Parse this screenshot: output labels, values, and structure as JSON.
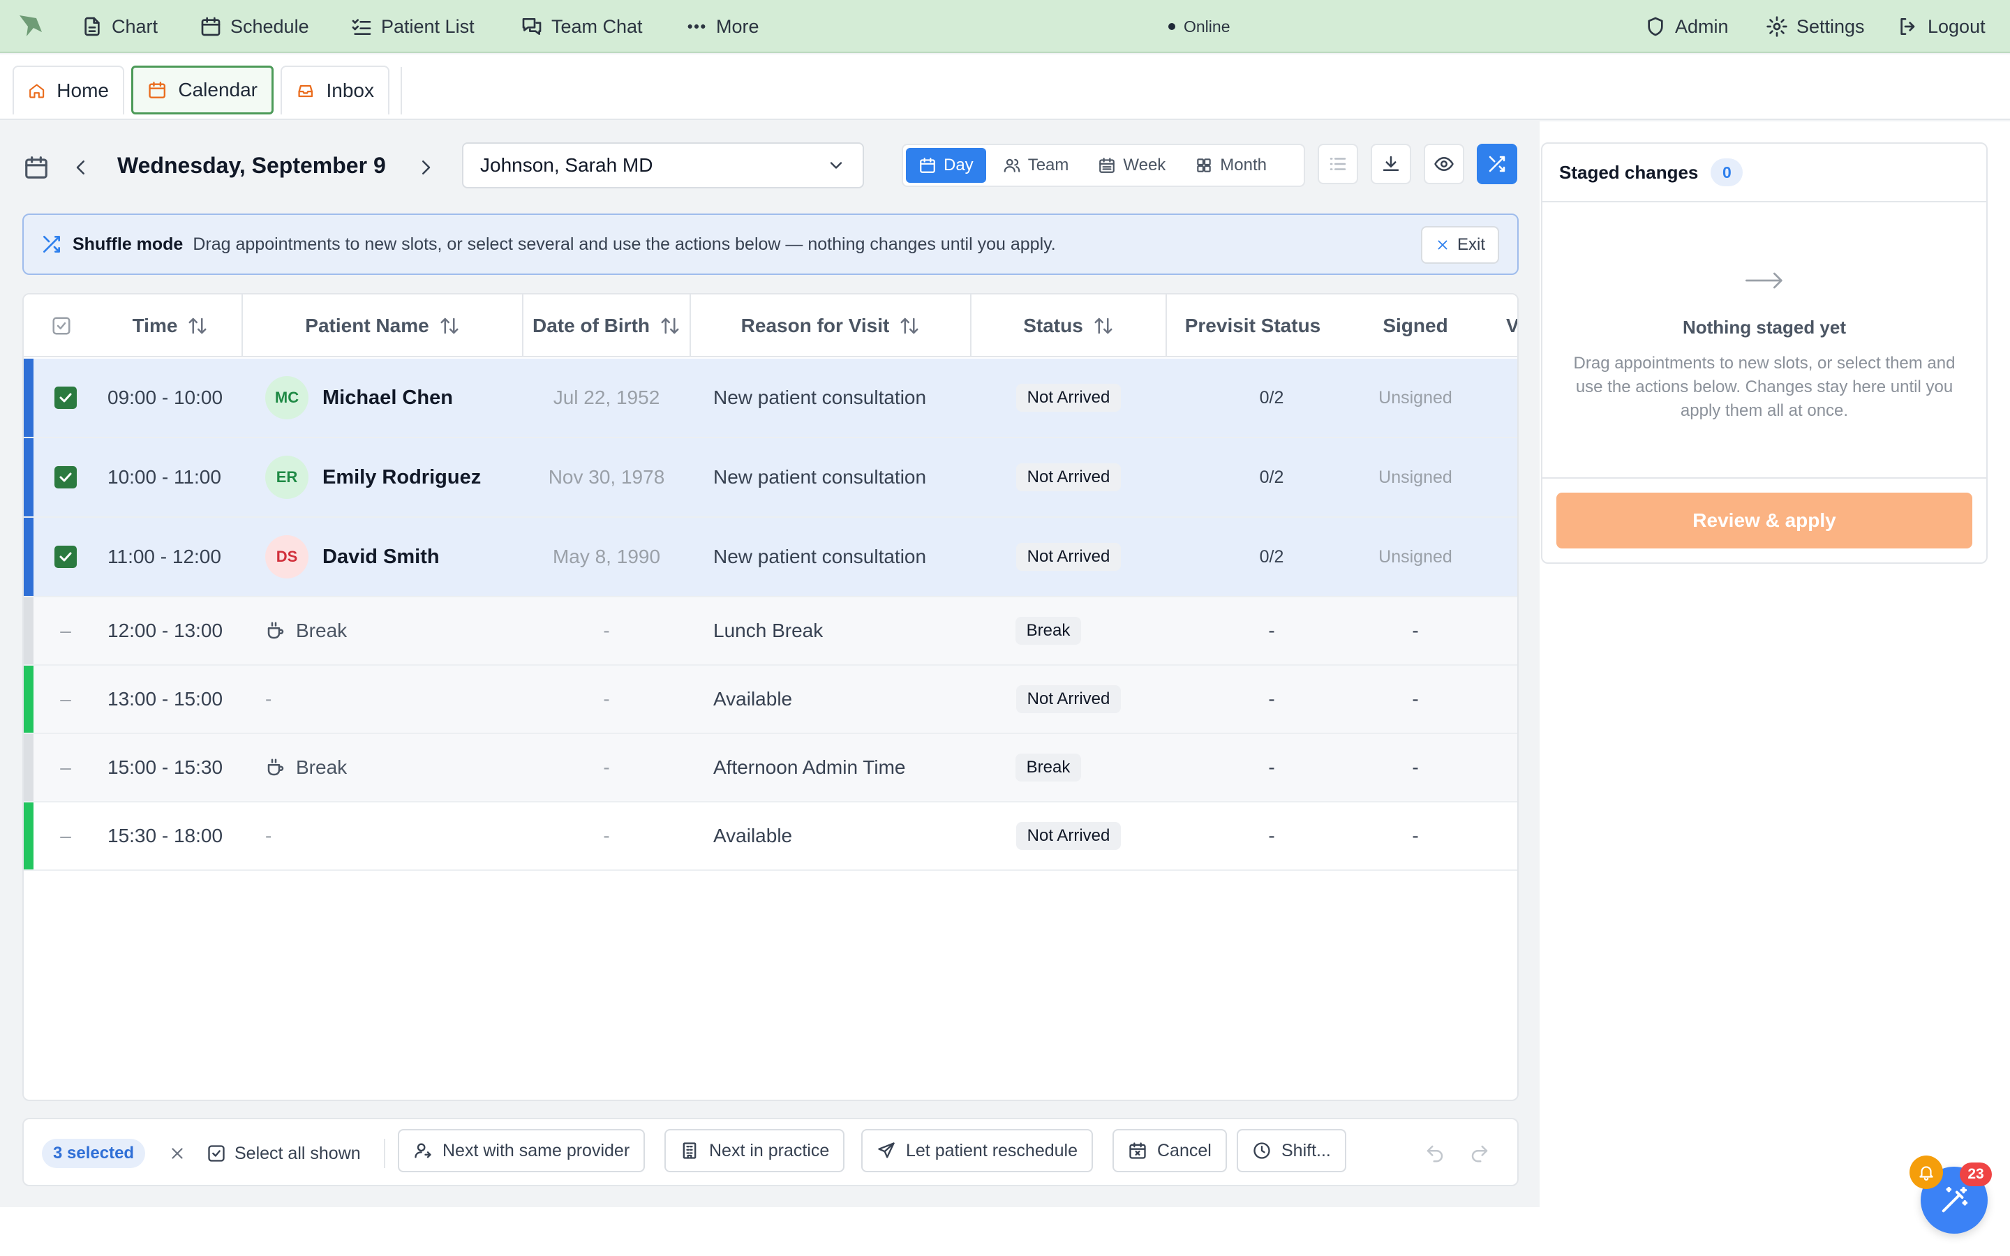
{
  "topnav": {
    "items": [
      {
        "label": "Chart",
        "icon": "document-icon"
      },
      {
        "label": "Schedule",
        "icon": "calendar-icon"
      },
      {
        "label": "Patient List",
        "icon": "list-check-icon"
      },
      {
        "label": "Team Chat",
        "icon": "chat-icon"
      },
      {
        "label": "More",
        "icon": "dots-icon"
      }
    ],
    "status": "Online",
    "right": [
      {
        "label": "Admin",
        "icon": "shield-icon"
      },
      {
        "label": "Settings",
        "icon": "gear-icon"
      },
      {
        "label": "Logout",
        "icon": "logout-icon"
      }
    ]
  },
  "tabs": [
    {
      "label": "Home",
      "icon": "home-icon",
      "active": false
    },
    {
      "label": "Calendar",
      "icon": "calendar-icon",
      "active": true
    },
    {
      "label": "Inbox",
      "icon": "inbox-icon",
      "active": false
    }
  ],
  "toolbar": {
    "date": "Wednesday, September 9",
    "provider": "Johnson, Sarah MD",
    "views": [
      "Day",
      "Team",
      "Week",
      "Month"
    ],
    "active_view": "Day"
  },
  "banner": {
    "title": "Shuffle mode",
    "text": "Drag appointments to new slots, or select several and use the actions below — nothing changes until you apply.",
    "exit": "Exit"
  },
  "table": {
    "headers": {
      "time": "Time",
      "patient": "Patient Name",
      "dob": "Date of Birth",
      "reason": "Reason for Visit",
      "status": "Status",
      "previsit": "Previsit Status",
      "signed": "Signed",
      "overflow": "V"
    },
    "rows": [
      {
        "time": "09:00 - 10:00",
        "initials": "MC",
        "name": "Michael Chen",
        "dob": "Jul 22, 1952",
        "reason": "New patient consultation",
        "status": "Not Arrived",
        "previsit": "0/2",
        "signed": "Unsigned"
      },
      {
        "time": "10:00 - 11:00",
        "initials": "ER",
        "name": "Emily Rodriguez",
        "dob": "Nov 30, 1978",
        "reason": "New patient consultation",
        "status": "Not Arrived",
        "previsit": "0/2",
        "signed": "Unsigned"
      },
      {
        "time": "11:00 - 12:00",
        "initials": "DS",
        "name": "David Smith",
        "dob": "May 8, 1990",
        "reason": "New patient consultation",
        "status": "Not Arrived",
        "previsit": "0/2",
        "signed": "Unsigned"
      },
      {
        "dash": "–",
        "time": "12:00 - 13:00",
        "name": "Break",
        "dob": "-",
        "reason": "Lunch Break",
        "status": "Break",
        "previsit": "-",
        "signed": "-"
      },
      {
        "dash": "–",
        "time": "13:00 - 15:00",
        "name": "-",
        "dob": "-",
        "reason": "Available",
        "status": "Not Arrived",
        "previsit": "-",
        "signed": "-"
      },
      {
        "dash": "–",
        "time": "15:00 - 15:30",
        "name": "Break",
        "dob": "-",
        "reason": "Afternoon Admin Time",
        "status": "Break",
        "previsit": "-",
        "signed": "-"
      },
      {
        "dash": "–",
        "time": "15:30 - 18:00",
        "name": "-",
        "dob": "-",
        "reason": "Available",
        "status": "Not Arrived",
        "previsit": "-",
        "signed": "-"
      }
    ]
  },
  "actionbar": {
    "selected": "3 selected",
    "select_all": "Select all shown",
    "next_same_provider": "Next with same provider",
    "next_in_practice": "Next in practice",
    "let_patient_reschedule": "Let patient reschedule",
    "cancel": "Cancel",
    "shift": "Shift..."
  },
  "staged": {
    "title": "Staged changes",
    "count": "0",
    "empty_title": "Nothing staged yet",
    "empty_text": "Drag appointments to new slots, or select them and use the actions below. Changes stay here until you apply them all at once.",
    "apply": "Review & apply"
  },
  "notifications": {
    "count": "23"
  },
  "colors": {
    "accent": "#2f80ed",
    "nav_bg": "#d4ecd6",
    "selected_bar": "#2f6fd6",
    "available_bar": "#22c55e",
    "break_bar": "#dcdfe3",
    "apply": "#fbb383"
  }
}
